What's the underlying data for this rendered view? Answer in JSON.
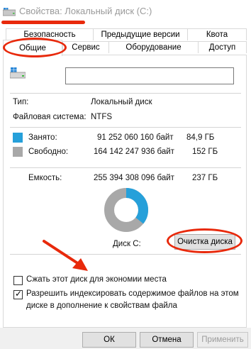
{
  "window": {
    "title": "Свойства: Локальный диск (C:)"
  },
  "tabs": {
    "row1": [
      {
        "label": "Безопасность"
      },
      {
        "label": "Предыдущие версии"
      },
      {
        "label": "Квота"
      }
    ],
    "row2": [
      {
        "label": "Общие"
      },
      {
        "label": "Сервис"
      },
      {
        "label": "Оборудование"
      },
      {
        "label": "Доступ"
      }
    ]
  },
  "general": {
    "name_value": "",
    "type_label": "Тип:",
    "type_value": "Локальный диск",
    "fs_label": "Файловая система:",
    "fs_value": "NTFS",
    "used": {
      "label": "Занято:",
      "bytes": "91 252 060 160 байт",
      "size": "84,9 ГБ",
      "color": "#26a0da"
    },
    "free": {
      "label": "Свободно:",
      "bytes": "164 142 247 936 байт",
      "size": "152 ГБ",
      "color": "#a8a8a8"
    },
    "capacity": {
      "label": "Емкость:",
      "bytes": "255 394 308 096 байт",
      "size": "237 ГБ"
    },
    "usage_fraction": 0.357,
    "disk_label": "Диск C:",
    "cleanup_button": "Очистка диска",
    "compress_checkbox": {
      "label": "Сжать этот диск для экономии места",
      "checked": false
    },
    "index_checkbox": {
      "label_line1": "Разрешить индексировать содержимое файлов на этом",
      "label_line2": "диске в дополнение к свойствам файла",
      "checked": true
    }
  },
  "buttons": {
    "ok": "ОК",
    "cancel": "Отмена",
    "apply": "Применить"
  },
  "colors": {
    "annotation": "#e8290b",
    "used": "#26a0da",
    "free": "#a8a8a8"
  }
}
